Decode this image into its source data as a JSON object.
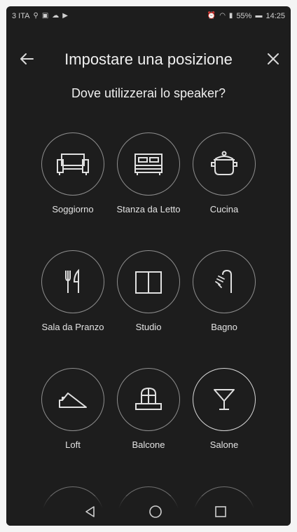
{
  "status_bar": {
    "carrier": "3 ITA",
    "battery": "55%",
    "time": "14:25"
  },
  "header": {
    "title": "Impostare una posizione",
    "back_icon": "arrow-left-icon",
    "close_icon": "close-icon"
  },
  "question": "Dove utilizzerai lo speaker?",
  "locations": [
    {
      "label": "Soggiorno",
      "icon": "sofa-icon"
    },
    {
      "label": "Stanza da Letto",
      "icon": "bed-icon"
    },
    {
      "label": "Cucina",
      "icon": "pot-icon"
    },
    {
      "label": "Sala da Pranzo",
      "icon": "fork-knife-icon"
    },
    {
      "label": "Studio",
      "icon": "book-icon"
    },
    {
      "label": "Bagno",
      "icon": "shower-icon"
    },
    {
      "label": "Loft",
      "icon": "loft-icon"
    },
    {
      "label": "Balcone",
      "icon": "balcony-icon"
    },
    {
      "label": "Salone",
      "icon": "cocktail-icon"
    }
  ],
  "nav_bar": {
    "back": "triangle-back-icon",
    "home": "circle-home-icon",
    "recents": "square-recents-icon"
  },
  "colors": {
    "background": "#1d1d1d",
    "ring": "#8e8e8e",
    "text": "#e6e6e6"
  }
}
